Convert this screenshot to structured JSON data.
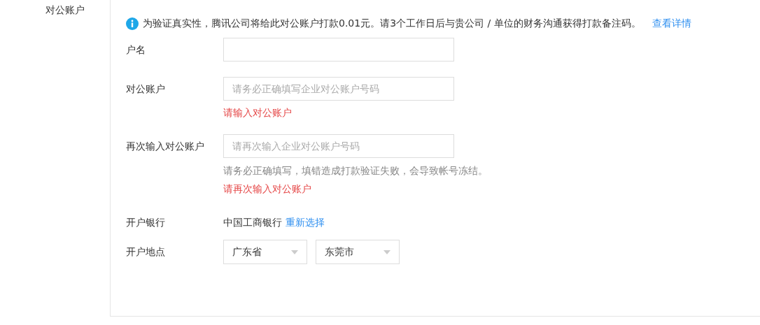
{
  "section_label": "对公账户",
  "notice": {
    "text": "为验证真实性，腾讯公司将给此对公账户打款0.01元。请3个工作日后与贵公司 / 单位的财务沟通获得打款备注码。",
    "link": "查看详情"
  },
  "fields": [
    {
      "kind": "input",
      "label": "户名"
    },
    {
      "kind": "input",
      "label": "对公账户",
      "placeholder": "请务必正确填写企业对公账户号码",
      "error": "请输入对公账户"
    },
    {
      "kind": "input",
      "label": "再次输入对公账户",
      "placeholder": "请再次输入企业对公账户号码",
      "hint": "请务必正确填写，填错造成打款验证失败，会导致帐号冻结。",
      "error": "请再次输入对公账户"
    },
    {
      "kind": "static",
      "label": "开户银行",
      "value": "中国工商银行",
      "link": "重新选择"
    },
    {
      "kind": "selects",
      "label": "开户地点",
      "selects": [
        "广东省",
        "东莞市"
      ]
    }
  ]
}
